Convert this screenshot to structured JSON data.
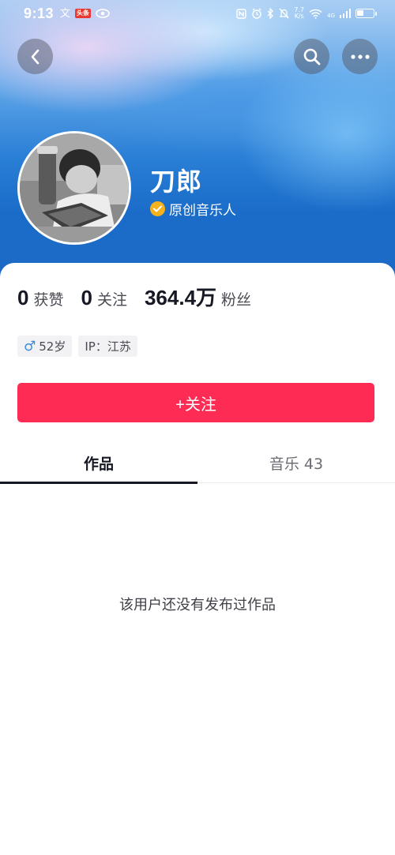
{
  "status_bar": {
    "time": "9:13",
    "app_badge": "头条",
    "net_speed_top": "7.7",
    "net_speed_bottom": "K/s",
    "signal_label": "4G",
    "battery_percent": 40
  },
  "profile": {
    "name": "刀郎",
    "verification": "原创音乐人",
    "verify_color": "#f6b21c"
  },
  "stats": [
    {
      "value": "0",
      "label": "获赞"
    },
    {
      "value": "0",
      "label": "关注"
    },
    {
      "value": "364.4万",
      "label": "粉丝"
    }
  ],
  "tags": {
    "gender_icon": "♂",
    "age": "52岁",
    "ip": "IP：江苏"
  },
  "follow_button": {
    "label": "+关注",
    "color": "#fe2c55"
  },
  "tabs": [
    {
      "label": "作品"
    },
    {
      "label": "音乐 43"
    }
  ],
  "empty_message": "该用户还没有发布过作品",
  "icons": {
    "back": "chevron-left-icon",
    "search": "search-icon",
    "more": "more-dots-icon"
  }
}
